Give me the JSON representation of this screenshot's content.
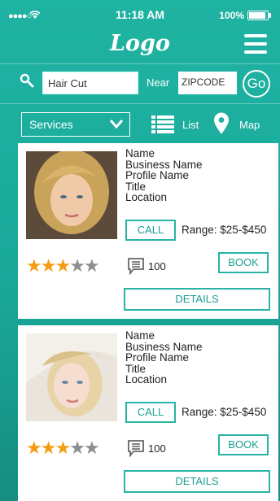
{
  "status_bar": {
    "signal": "●●●●○",
    "time": "11:18 AM",
    "battery_text": "100%"
  },
  "header": {
    "logo": "Logo"
  },
  "search": {
    "query_value": "Hair Cut",
    "near_label": "Near",
    "zip_placeholder": "ZIPCODE",
    "go_label": "Go"
  },
  "filters": {
    "services_label": "Services",
    "list_label": "List",
    "map_label": "Map"
  },
  "results": [
    {
      "name": "Name",
      "business_name": "Business Name",
      "profile_name": "Profile Name",
      "title": "Title",
      "location": "Location",
      "call_label": "CALL",
      "range": "Range: $25-$450",
      "rating": 3,
      "rating_max": 5,
      "comment_count": "100",
      "book_label": "BOOK",
      "details_label": "DETAILS"
    },
    {
      "name": "Name",
      "business_name": "Business Name",
      "profile_name": "Profile Name",
      "title": "Title",
      "location": "Location",
      "call_label": "CALL",
      "range": "Range: $25-$450",
      "rating": 3,
      "rating_max": 5,
      "comment_count": "100",
      "book_label": "BOOK",
      "details_label": "DETAILS"
    }
  ],
  "colors": {
    "accent": "#1fb3a2",
    "button_border": "#28b3a5",
    "star_on": "#f39c12",
    "star_off": "#8e8e8e"
  }
}
